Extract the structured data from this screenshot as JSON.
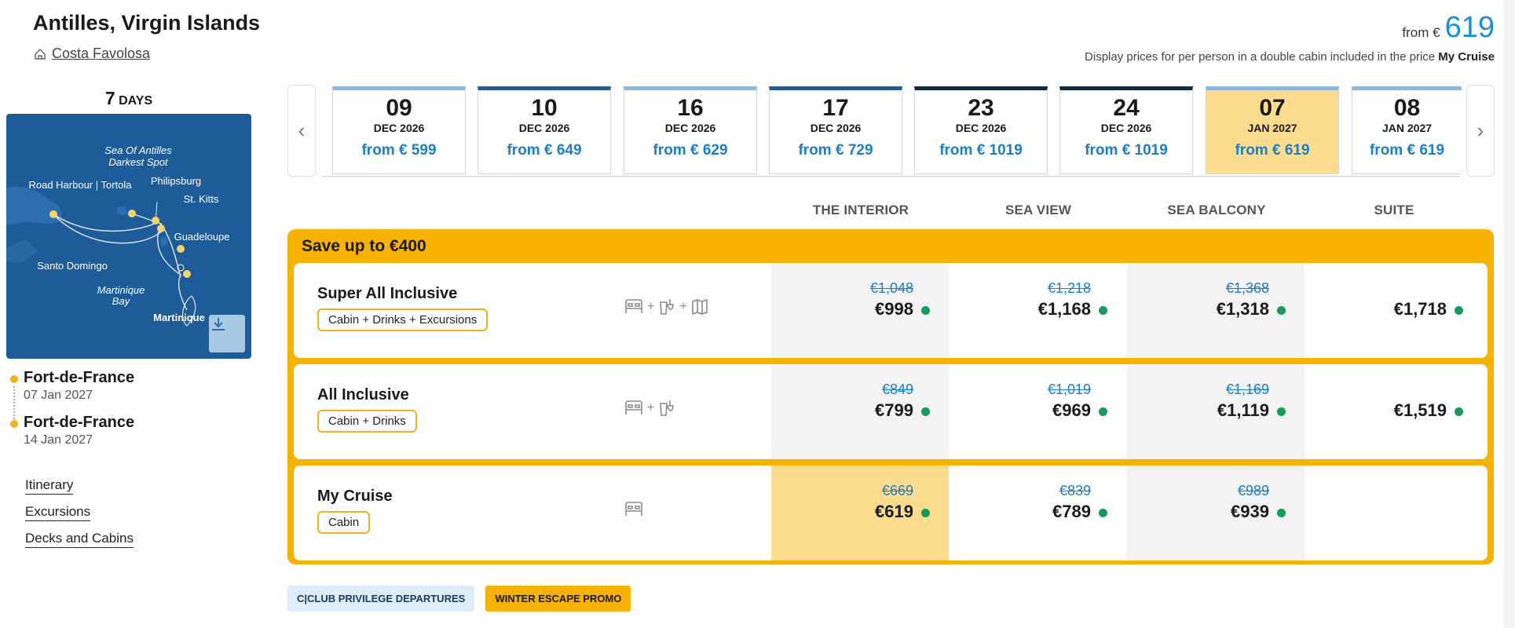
{
  "header": {
    "title": "Antilles, Virgin Islands",
    "ship": "Costa Favolosa",
    "from_label": "from €",
    "from_value": "619",
    "display_note_prefix": "Display prices for per person in a double cabin included in the price",
    "display_note_bold": "My Cruise"
  },
  "itinerary": {
    "days_number": "7",
    "days_unit": "DAYS",
    "map_labels": [
      "Sea Of Antilles",
      "Darkest Spot",
      "Road Harbour | Tortola",
      "Philipsburg",
      "St. Kitts",
      "Guadeloupe",
      "Santo Domingo",
      "Martinique",
      "Bay",
      "Martinique"
    ],
    "departure_port": "Fort-de-France",
    "departure_date": "07 Jan 2027",
    "arrival_port": "Fort-de-France",
    "arrival_date": "14 Jan 2027"
  },
  "links": [
    "Itinerary",
    "Excursions",
    "Decks and Cabins"
  ],
  "dates": [
    {
      "day": "09",
      "month": "DEC 2026",
      "price": "from € 599",
      "color": "#8fb8d8"
    },
    {
      "day": "10",
      "month": "DEC 2026",
      "price": "from € 649",
      "color": "#2a5a8a"
    },
    {
      "day": "16",
      "month": "DEC 2026",
      "price": "from € 629",
      "color": "#8fb8d8"
    },
    {
      "day": "17",
      "month": "DEC 2026",
      "price": "from € 729",
      "color": "#2a5a8a"
    },
    {
      "day": "23",
      "month": "DEC 2026",
      "price": "from € 1019",
      "color": "#0e2a45"
    },
    {
      "day": "24",
      "month": "DEC 2026",
      "price": "from € 1019",
      "color": "#0e2a45"
    },
    {
      "day": "07",
      "month": "JAN 2027",
      "price": "from € 619",
      "color": "#8fb8d8",
      "selected": true
    },
    {
      "day": "08",
      "month": "JAN 2027",
      "price": "from € 619",
      "color": "#8fb8d8"
    }
  ],
  "cabin_types": [
    "THE INTERIOR",
    "SEA VIEW",
    "SEA BALCONY",
    "SUITE"
  ],
  "offers": {
    "save_text": "Save up to €400",
    "packages": [
      {
        "name": "Super All Inclusive",
        "tag": "Cabin + Drinks + Excursions",
        "icons": [
          "bed-icon",
          "drinks-icon",
          "map-icon"
        ],
        "prices": [
          {
            "old": "€1,048",
            "new": "€998"
          },
          {
            "old": "€1,218",
            "new": "€1,168"
          },
          {
            "old": "€1,368",
            "new": "€1,318"
          },
          {
            "old": "",
            "new": "€1,718"
          }
        ]
      },
      {
        "name": "All Inclusive",
        "tag": "Cabin + Drinks",
        "icons": [
          "bed-icon",
          "drinks-icon"
        ],
        "prices": [
          {
            "old": "€849",
            "new": "€799"
          },
          {
            "old": "€1,019",
            "new": "€969"
          },
          {
            "old": "€1,169",
            "new": "€1,119"
          },
          {
            "old": "",
            "new": "€1,519"
          }
        ]
      },
      {
        "name": "My Cruise",
        "tag": "Cabin",
        "icons": [
          "bed-icon"
        ],
        "prices": [
          {
            "old": "€669",
            "new": "€619"
          },
          {
            "old": "€839",
            "new": "€789"
          },
          {
            "old": "€989",
            "new": "€939"
          }
        ]
      }
    ]
  },
  "badges": [
    "C|CLUB PRIVILEGE DEPARTURES",
    "WINTER ESCAPE PROMO"
  ],
  "colors": {
    "accent": "#f7b100",
    "price_blue": "#1a7ec9",
    "selected_bg": "#fbdc8e",
    "availability": "#149a5a"
  }
}
